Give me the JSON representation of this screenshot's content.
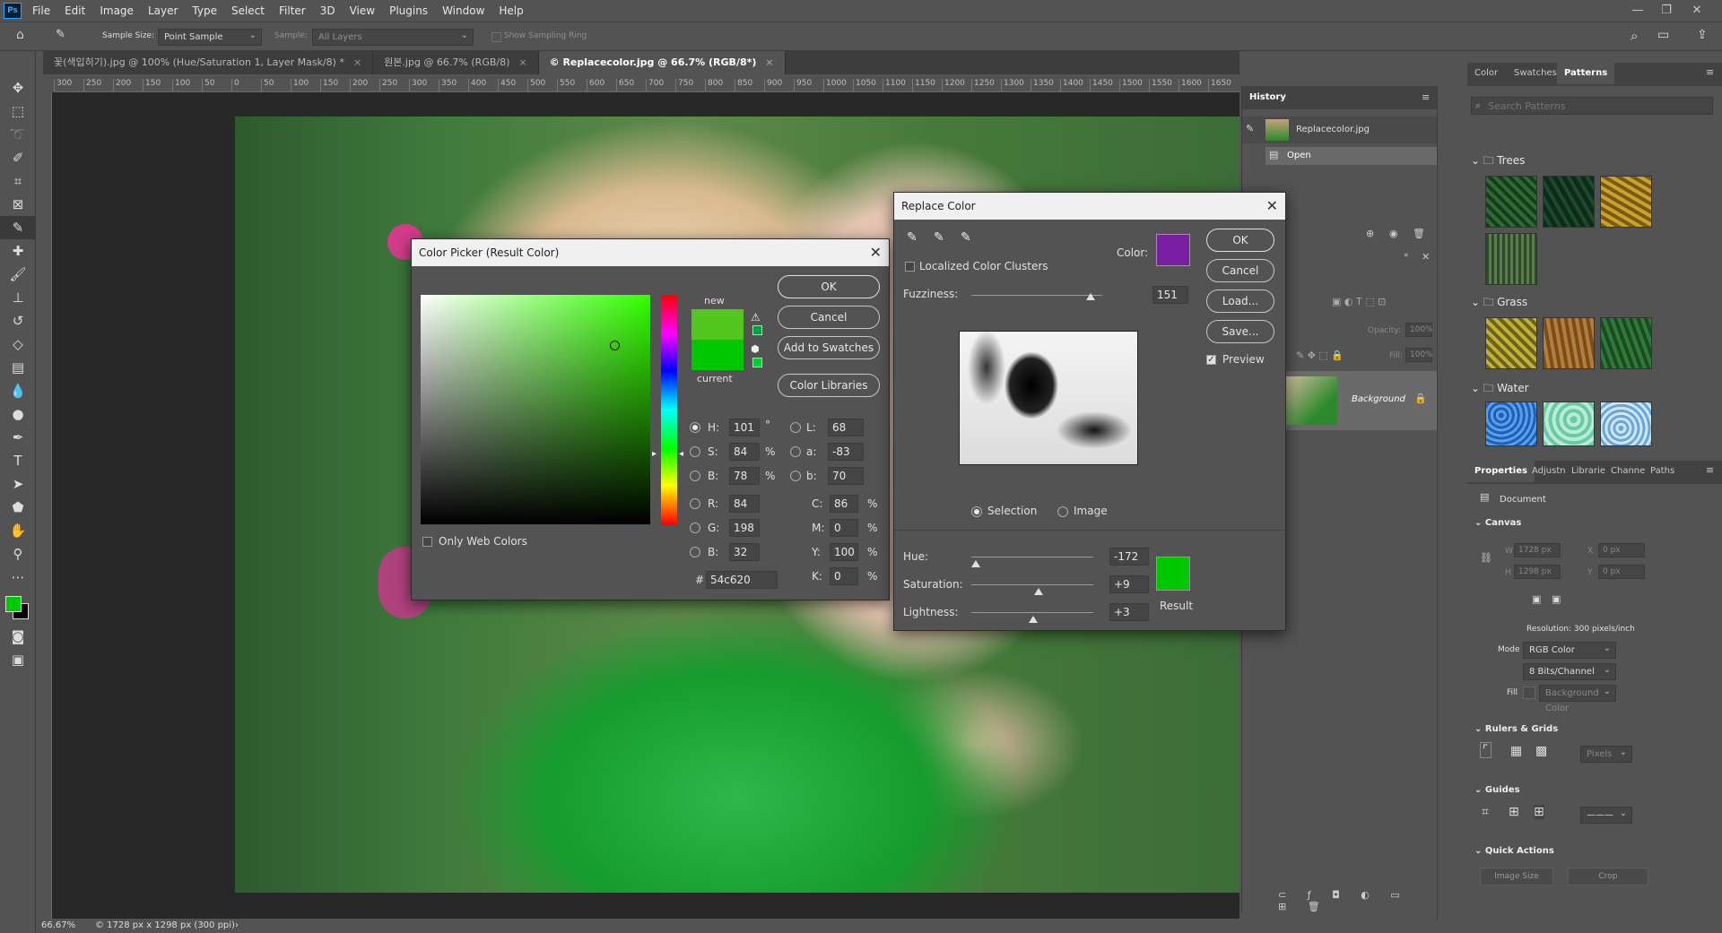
{
  "app": {
    "logo": "Ps"
  },
  "menu": [
    "File",
    "Edit",
    "Image",
    "Layer",
    "Type",
    "Select",
    "Filter",
    "3D",
    "View",
    "Plugins",
    "Window",
    "Help"
  ],
  "options": {
    "sample_size_label": "Sample Size:",
    "sample_size_value": "Point Sample",
    "sample_label": "Sample:",
    "sample_value": "All Layers",
    "show_ring": "Show Sampling Ring"
  },
  "tabs": [
    {
      "label": "꽃(색입히기).jpg @ 100% (Hue/Saturation 1, Layer Mask/8) *"
    },
    {
      "label": "원본.jpg @ 66.7% (RGB/8)"
    },
    {
      "label": "© Replacecolor.jpg @ 66.7% (RGB/8*)"
    }
  ],
  "ruler_ticks": [
    "300",
    "250",
    "200",
    "150",
    "100",
    "50",
    "0",
    "50",
    "100",
    "150",
    "200",
    "250",
    "300",
    "350",
    "400",
    "450",
    "500",
    "550",
    "600",
    "650",
    "700",
    "750",
    "800",
    "850",
    "900",
    "950",
    "1000",
    "1050",
    "1100",
    "1150",
    "1200",
    "1250",
    "1300",
    "1350",
    "1400",
    "1450",
    "1500",
    "1550",
    "1600",
    "1650"
  ],
  "status": {
    "zoom": "66.67%",
    "info": "© 1728 px x 1298 px (300 ppi)"
  },
  "history": {
    "title": "History",
    "snapshot": "Replacecolor.jpg",
    "step": "Open"
  },
  "layers": {
    "opacity_label": "Opacity:",
    "opacity": "100%",
    "fill_label": "Fill:",
    "fill": "100%",
    "layer_name": "Background"
  },
  "right_tabs": [
    "Color",
    "Swatches",
    "Patterns"
  ],
  "patterns": {
    "search_placeholder": "Search Patterns",
    "groups": [
      "Trees",
      "Grass",
      "Water"
    ]
  },
  "properties": {
    "tabs": [
      "Properties",
      "Adjustn",
      "Librarie",
      "Channe",
      "Paths"
    ],
    "doc_label": "Document",
    "canvas_head": "Canvas",
    "w_label": "W",
    "w": "1728 px",
    "h_label": "H",
    "h": "1298 px",
    "x_label": "X",
    "x": "0 px",
    "y_label": "Y",
    "y": "0 px",
    "resolution": "Resolution: 300 pixels/inch",
    "mode_label": "Mode",
    "mode": "RGB Color",
    "bits": "8 Bits/Channel",
    "fill_label": "Fill",
    "fill_value": "Background Color",
    "rulers_head": "Rulers & Grids",
    "units": "Pixels",
    "guides_head": "Guides",
    "quick_head": "Quick Actions",
    "image_size": "Image Size",
    "crop": "Crop"
  },
  "colorpicker": {
    "title": "Color Picker (Result Color)",
    "ok": "OK",
    "cancel": "Cancel",
    "add_swatches": "Add to Swatches",
    "libraries": "Color Libraries",
    "new_label": "new",
    "current_label": "current",
    "only_web": "Only Web Colors",
    "h_label": "H:",
    "h": "101",
    "h_unit": "°",
    "s_label": "S:",
    "s": "84",
    "s_unit": "%",
    "b_label": "B:",
    "b": "78",
    "b_unit": "%",
    "r_label": "R:",
    "r": "84",
    "g_label": "G:",
    "g": "198",
    "bb_label": "B:",
    "bb": "32",
    "l_label": "L:",
    "l": "68",
    "a_label": "a:",
    "a": "-83",
    "lb_label": "b:",
    "lb": "70",
    "c_label": "C:",
    "c": "86",
    "m_label": "M:",
    "m": "0",
    "y_label": "Y:",
    "y": "100",
    "k_label": "K:",
    "k": "0",
    "pct": "%",
    "hash": "#",
    "hex": "54c620",
    "new_color": "#54c620",
    "current_color": "#00c800"
  },
  "replace": {
    "title": "Replace Color",
    "ok": "OK",
    "cancel": "Cancel",
    "load": "Load...",
    "save": "Save...",
    "preview": "Preview",
    "localized": "Localized Color Clusters",
    "color_label": "Color:",
    "sample_color": "#7b1fa2",
    "fuzziness_label": "Fuzziness:",
    "fuzziness": "151",
    "selection": "Selection",
    "image": "Image",
    "hue_label": "Hue:",
    "hue": "-172",
    "sat_label": "Saturation:",
    "sat": "+9",
    "light_label": "Lightness:",
    "light": "+3",
    "result_label": "Result",
    "result_color": "#00c800"
  }
}
